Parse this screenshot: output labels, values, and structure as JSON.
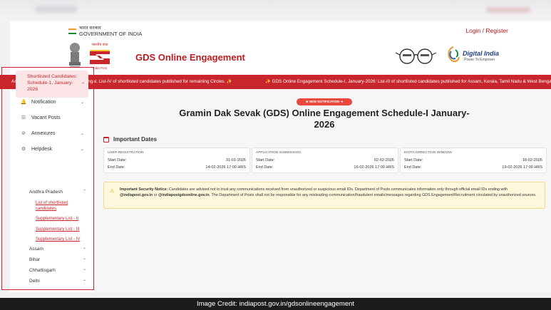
{
  "header": {
    "goi_hindi": "भारत सरकार",
    "goi_english": "GOVERNMENT OF INDIA",
    "login_label": "Login / Register",
    "site_title": "GDS Online Engagement",
    "post_logo_text": "India Post",
    "digital_india": "Digital India",
    "digital_india_tagline": "Power To Empower",
    "colors": {
      "brand_red": "#b81c22",
      "ticker_red": "#c8262c"
    }
  },
  "ticker": {
    "item1": "Assam, Kerala, Tamil Nadu & West Bengal. List-IV of shortlisted candidates published for remaining Circles. ✨",
    "item2": "✨ GDS Online Engagement Schedule-I, January-2026: List-III of shortlisted candidates published for Assam, Kerala, Tamil Nadu & West Bengal."
  },
  "sidebar": {
    "items": [
      {
        "label": "Notification",
        "icon": "bell-icon"
      },
      {
        "label": "Vacant Posts",
        "icon": "list-icon"
      },
      {
        "label": "Annexures",
        "icon": "paperclip-icon"
      },
      {
        "label": "Helpdesk",
        "icon": "gear-icon"
      }
    ],
    "active_label": "Shortlisted Candidates: Schedule-1, January-2026",
    "regions": [
      "Andhra Pradesh",
      "Assam",
      "Bihar",
      "Chhattisgarh",
      "Delhi"
    ],
    "sublinks": [
      "List of shortlisted candidates",
      "Supplementary List - II",
      "Supplementary List - III",
      "Supplementary List - IV"
    ]
  },
  "main": {
    "badge": "★ NEW NOTIFICATION ➜",
    "heading": "Gramin Dak Sevak (GDS) Online Engagement Schedule-I January-2026",
    "dates_title": "Important Dates",
    "cards": [
      {
        "title": "USER REGISTRATION",
        "start_label": "Start Date:",
        "start": "31-01-2026",
        "end_label": "End Date:",
        "end": "14-02-2026 17:00 HRS"
      },
      {
        "title": "APPLICATION SUBMISSION",
        "start_label": "Start Date:",
        "start": "02-02-2026",
        "end_label": "End Date:",
        "end": "16-02-2026 17:00 HRS"
      },
      {
        "title": "EDIT/CORRECTION WINDOW",
        "start_label": "Start Date:",
        "start": "18-02-2026",
        "end_label": "End Date:",
        "end": "19-02-2026 17:00 HRS"
      }
    ],
    "notice": {
      "label": "Important Security Notice:",
      "part1": " Candidates are advised not to trust any communications received from unauthorized or suspicious email IDs. Department of Posts communicates information only through official email IDs ending with ",
      "email1": "@indiapost.gov.in",
      "part2": " or ",
      "email2": "@indiapostgdsonline.gov.in",
      "part3": ". The Department of Posts shall not be responsible for any misleading communication/fraudulent emails/messages regarding GDS Engagement/Recruitment circulated by unauthorized sources."
    }
  },
  "credit": "Image Credit: indiapost.gov.in/gdsonlineengagement"
}
